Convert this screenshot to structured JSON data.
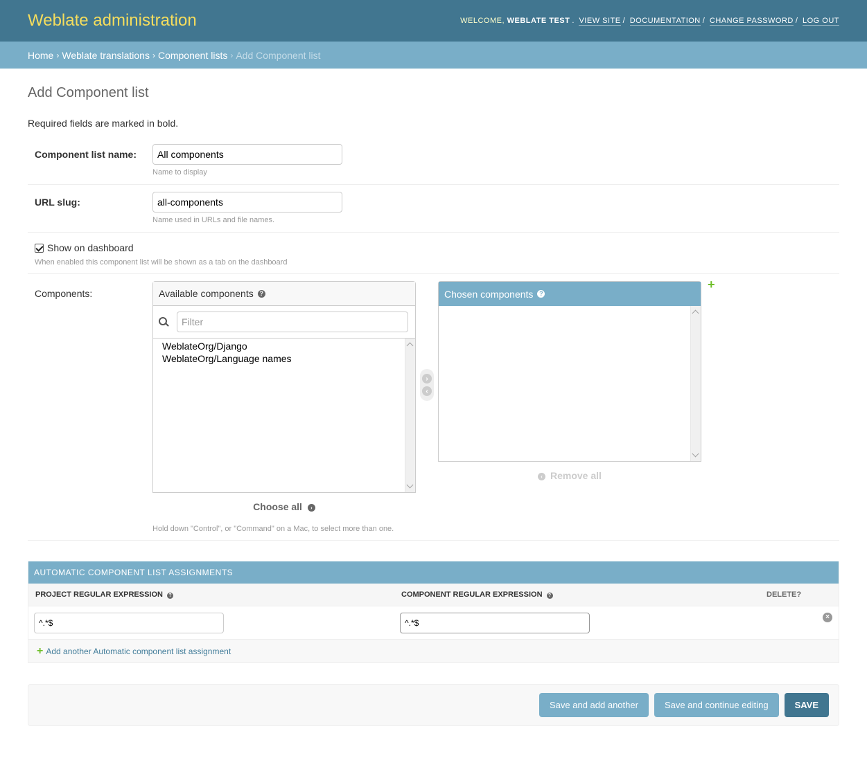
{
  "header": {
    "branding": "Weblate administration",
    "welcome": "WELCOME,",
    "user": "WEBLATE TEST",
    "links": [
      "VIEW SITE",
      "DOCUMENTATION",
      "CHANGE PASSWORD",
      "LOG OUT"
    ]
  },
  "breadcrumbs": {
    "items": [
      "Home",
      "Weblate translations",
      "Component lists"
    ],
    "current": "Add Component list"
  },
  "page": {
    "title": "Add Component list",
    "note": "Required fields are marked in bold."
  },
  "form": {
    "name": {
      "label": "Component list name:",
      "value": "All components",
      "help": "Name to display"
    },
    "slug": {
      "label": "URL slug:",
      "value": "all-components",
      "help": "Name used in URLs and file names."
    },
    "dashboard": {
      "label": "Show on dashboard",
      "checked": true,
      "help": "When enabled this component list will be shown as a tab on the dashboard"
    },
    "components": {
      "label": "Components:",
      "available_title": "Available components",
      "filter_placeholder": "Filter",
      "available": [
        "WeblateOrg/Django",
        "WeblateOrg/Language names"
      ],
      "chosen_title": "Chosen components",
      "chosen": [],
      "choose_all": "Choose all",
      "remove_all": "Remove all",
      "help": "Hold down \"Control\", or \"Command\" on a Mac, to select more than one."
    }
  },
  "inline": {
    "title": "AUTOMATIC COMPONENT LIST ASSIGNMENTS",
    "col_project": "PROJECT REGULAR EXPRESSION",
    "col_component": "COMPONENT REGULAR EXPRESSION",
    "col_delete": "DELETE?",
    "rows": [
      {
        "project": "^.*$",
        "component": "^.*$"
      }
    ],
    "add_another": "Add another Automatic component list assignment"
  },
  "submit": {
    "save_add": "Save and add another",
    "save_continue": "Save and continue editing",
    "save": "SAVE"
  },
  "colors": {
    "header": "#417690",
    "branding": "#f5dd5d",
    "accent": "#79aec8",
    "add": "#70bf2b"
  }
}
